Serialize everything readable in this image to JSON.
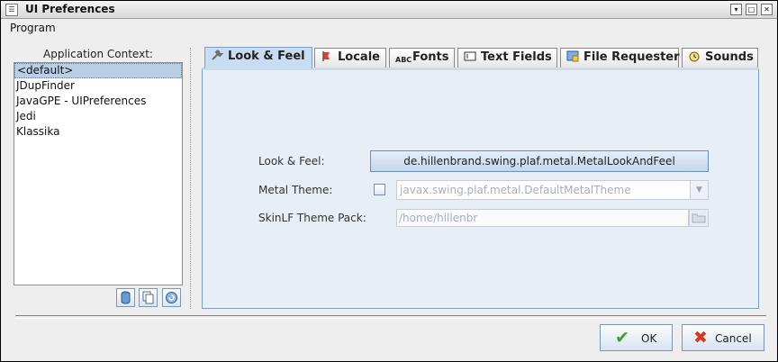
{
  "window": {
    "title": "UI Preferences"
  },
  "menu": {
    "items": [
      "Program"
    ]
  },
  "context": {
    "label": "Application Context:",
    "items": [
      "<default>",
      "JDupFinder",
      "JavaGPE - UIPreferences",
      "Jedi",
      "Klassika"
    ],
    "selected_index": 0
  },
  "tabs": [
    {
      "label": "Look & Feel",
      "icon": "wrench-icon",
      "active": true
    },
    {
      "label": "Locale",
      "icon": "pin-icon",
      "active": false
    },
    {
      "label": "Fonts",
      "icon": "font-icon",
      "active": false
    },
    {
      "label": "Text Fields",
      "icon": "textfield-icon",
      "active": false
    },
    {
      "label": "File Requester",
      "icon": "file-requester-icon",
      "active": false
    },
    {
      "label": "Sounds",
      "icon": "alarm-clock-icon",
      "active": false
    }
  ],
  "laf": {
    "look_feel_label": "Look & Feel:",
    "look_feel_value": "de.hillenbrand.swing.plaf.metal.MetalLookAndFeel",
    "metal_theme_label": "Metal Theme:",
    "metal_theme_checked": false,
    "metal_theme_value": "javax.swing.plaf.metal.DefaultMetalTheme",
    "skinlf_label": "SkinLF Theme Pack:",
    "skinlf_value": "/home/hillenbr"
  },
  "buttons": {
    "ok": "OK",
    "cancel": "Cancel"
  },
  "colors": {
    "accent": "#c8ddf2",
    "panel": "#e7eef6",
    "ok_check": "#3aa12a",
    "cancel_x": "#d33a26",
    "selection": "#b8cfe5"
  }
}
